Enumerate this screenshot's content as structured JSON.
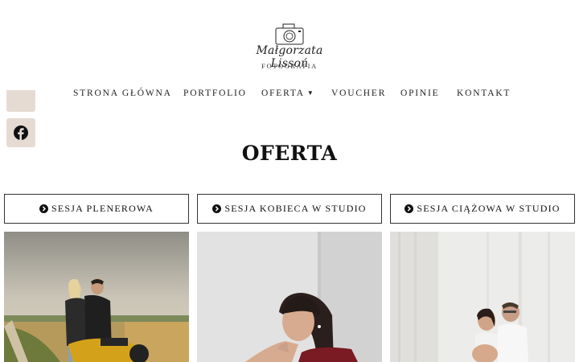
{
  "brand": {
    "name": "Małgorzata Lissoń",
    "subtitle": "FOTOGRAFIA"
  },
  "nav": {
    "items": [
      {
        "label": "STRONA GŁÓWNA"
      },
      {
        "label": "PORTFOLIO"
      },
      {
        "label": "OFERTA",
        "has_dropdown": true
      },
      {
        "label": "VOUCHER"
      },
      {
        "label": "OPINIE"
      },
      {
        "label": "KONTAKT"
      }
    ]
  },
  "social": {
    "facebook_icon": "facebook-icon",
    "bg_color": "#e6dbd3"
  },
  "page": {
    "title": "OFERTA"
  },
  "categories": [
    {
      "label": "SESJA PLENEROWA",
      "icon": "circle-chevron-right-icon"
    },
    {
      "label": "SESJA KOBIECA W STUDIO",
      "icon": "circle-chevron-right-icon"
    },
    {
      "label": "SESJA CIĄŻOWA W STUDIO",
      "icon": "circle-chevron-right-icon"
    }
  ],
  "photos": [
    {
      "subject": "couple-with-motorcycle-photo"
    },
    {
      "subject": "woman-studio-portrait-photo"
    },
    {
      "subject": "maternity-couple-photo"
    }
  ]
}
